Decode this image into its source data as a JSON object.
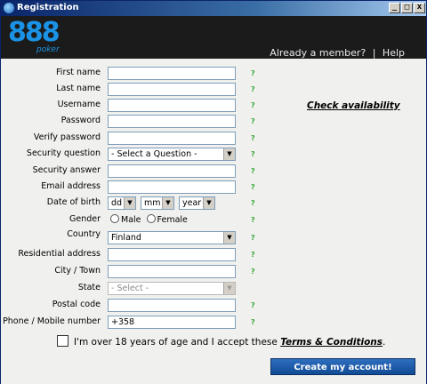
{
  "window": {
    "title": "Registration",
    "controls": [
      "_",
      "□",
      "x"
    ]
  },
  "header": {
    "logo_number": "888",
    "logo_word": "poker",
    "already_member": "Already a member?",
    "separator": "|",
    "help": "Help",
    "colors": {
      "background": "#1b1b1b",
      "brand": "#1a93e6"
    }
  },
  "form": {
    "first_name": {
      "label": "First name",
      "value": ""
    },
    "last_name": {
      "label": "Last name",
      "value": ""
    },
    "username": {
      "label": "Username",
      "value": ""
    },
    "password": {
      "label": "Password",
      "value": ""
    },
    "verify_password": {
      "label": "Verify password",
      "value": ""
    },
    "security_question": {
      "label": "Security question",
      "value": "- Select a Question -"
    },
    "security_answer": {
      "label": "Security answer",
      "value": ""
    },
    "email": {
      "label": "Email address",
      "value": ""
    },
    "dob": {
      "label": "Date of birth",
      "day": "dd",
      "month": "mm",
      "year": "year"
    },
    "gender": {
      "label": "Gender",
      "male": "Male",
      "female": "Female"
    },
    "country": {
      "label": "Country",
      "value": "Finland"
    },
    "residential_address": {
      "label": "Residential address",
      "value": ""
    },
    "city": {
      "label": "City / Town",
      "value": ""
    },
    "state": {
      "label": "State",
      "value": "- Select -"
    },
    "postal_code": {
      "label": "Postal code",
      "value": ""
    },
    "phone": {
      "label": "Phone / Mobile number",
      "value": "+358"
    },
    "help_mark": "?",
    "check_availability": "Check availability",
    "terms_prefix": "I'm over 18 years of age and I accept these ",
    "terms_link": "Terms & Conditions",
    "terms_suffix": ".",
    "submit": "Create my account!",
    "colors": {
      "help": "#3aa63a",
      "button": "#1c5aa8"
    }
  }
}
